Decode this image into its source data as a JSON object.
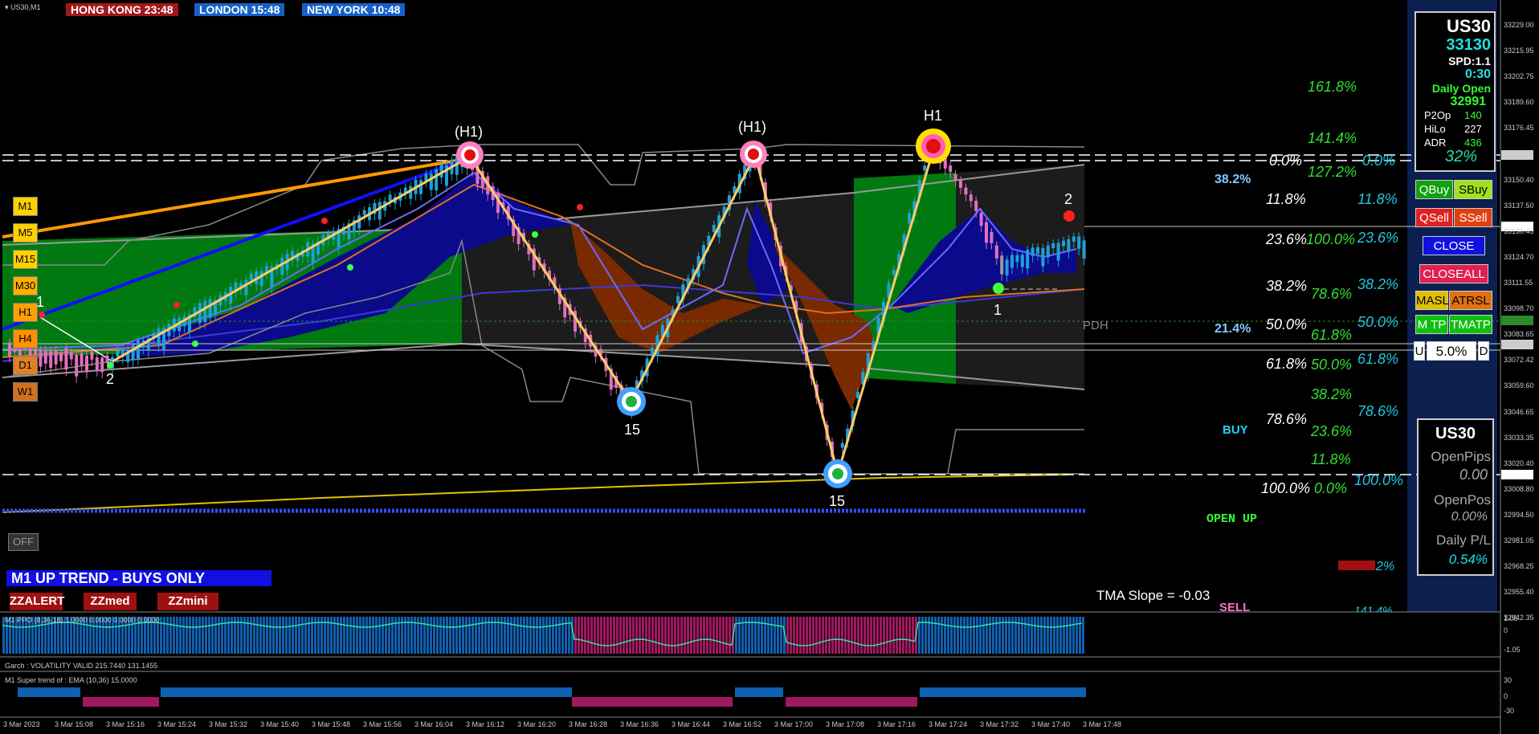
{
  "window": {
    "title": "US30,M1"
  },
  "clocks": [
    {
      "label": "HONG KONG 23:48",
      "color": "#a01818"
    },
    {
      "label": "LONDON  15:48",
      "color": "#1560c8"
    },
    {
      "label": "NEW YORK  10:48",
      "color": "#1560c8"
    }
  ],
  "timeframes": [
    {
      "label": "M1",
      "color": "#ffd000"
    },
    {
      "label": "M5",
      "color": "#ffd000"
    },
    {
      "label": "M15",
      "color": "#ffd000"
    },
    {
      "label": "M30",
      "color": "#ffb000"
    },
    {
      "label": "H1",
      "color": "#ffa000"
    },
    {
      "label": "H4",
      "color": "#ff9000"
    },
    {
      "label": "D1",
      "color": "#e08020"
    },
    {
      "label": "W1",
      "color": "#d07020"
    }
  ],
  "swing_labels": {
    "h1_left": "(H1)",
    "h1_mid": "(H1)",
    "h1_right": "H1",
    "low_mid": "15",
    "low_right": "15",
    "num_2_left": "2",
    "num_1_left": "1",
    "num_2_right": "2",
    "num_1_right": "1"
  },
  "fib_levels": {
    "col_a": [
      "0.0%",
      "11.8%",
      "23.6%",
      "38.2%",
      "50.0%",
      "61.8%",
      "78.6%",
      "100.0%"
    ],
    "col_b": [
      "161.8%",
      "141.4%",
      "127.2%",
      "100.0%",
      "78.6%",
      "61.8%",
      "50.0%",
      "38.2%",
      "23.6%",
      "11.8%",
      "0.0%"
    ],
    "col_c": [
      "0.0%",
      "11.8%",
      "23.6%",
      "38.2%",
      "50.0%",
      "61.8%",
      "78.6%",
      "100.0%"
    ],
    "extra_382": "38.2%",
    "extra_214": "21.4%",
    "bottom_partial": "11.2%",
    "bottom_partial2": "141.4%"
  },
  "signals": {
    "buy": "BUY",
    "open_up": "OPEN UP",
    "sell": "SELL",
    "pdh": "PDH"
  },
  "tma_slope": "TMA Slope = -0.03",
  "trend_banner": "M1 UP TREND - BUYS ONLY",
  "off_button": "OFF",
  "zz_buttons": [
    "ZZALERT",
    "ZZmed",
    "ZZmini"
  ],
  "info_panel": {
    "symbol": "US30",
    "price": "33130",
    "spread": "SPD:1.1",
    "timer": "0:30",
    "daily_open_label": "Daily Open",
    "daily_open": "32991",
    "rows": [
      {
        "label": "P2Op",
        "value": "140"
      },
      {
        "label": "HiLo",
        "value": "227"
      },
      {
        "label": "ADR",
        "value": "436"
      }
    ],
    "adr_pct": "32%"
  },
  "trade_buttons": {
    "qbuy": "QBuy",
    "sbuy": "SBuy",
    "qsell": "QSell",
    "ssell": "SSell",
    "close": "CLOSE",
    "closeall": "CLOSEALL",
    "masl": "MASL",
    "atrsl": "ATRSL",
    "mtp": "M TP",
    "tmatp": "TMATP",
    "u": "U",
    "risk": "5.0%",
    "d": "D"
  },
  "stats_panel": {
    "symbol": "US30",
    "open_pips_label": "OpenPips",
    "open_pips": "0.00",
    "open_pos_label": "OpenPos",
    "open_pos": "0.00%",
    "daily_pl_label": "Daily P/L",
    "daily_pl": "0.54%"
  },
  "price_axis": [
    "33229.00",
    "33215.95",
    "33202.75",
    "33189.60",
    "33176.45",
    "33165.77",
    "33150.40",
    "33137.50",
    "33130.45",
    "33124.70",
    "33111.55",
    "33098.70",
    "33083.65",
    "33072.42",
    "33059.60",
    "33046.65",
    "33033.35",
    "33020.40",
    "33008.80",
    "32994.50",
    "32981.05",
    "32968.25",
    "32955.40",
    "32942.35"
  ],
  "time_axis": [
    "3 Mar 2023",
    "3 Mar 15:08",
    "3 Mar 15:16",
    "3 Mar 15:24",
    "3 Mar 15:32",
    "3 Mar 15:40",
    "3 Mar 15:48",
    "3 Mar 15:56",
    "3 Mar 16:04",
    "3 Mar 16:12",
    "3 Mar 16:20",
    "3 Mar 16:28",
    "3 Mar 16:36",
    "3 Mar 16:44",
    "3 Mar 16:52",
    "3 Mar 17:00",
    "3 Mar 17:08",
    "3 Mar 17:16",
    "3 Mar 17:24",
    "3 Mar 17:32",
    "3 Mar 17:40",
    "3 Mar 17:48"
  ],
  "sub_windows": [
    {
      "title": "M1 PPO (8,36,18) 1.0000 0.0000 0.0000 0.0000",
      "scale": [
        "1.05",
        "0",
        "-1.05"
      ]
    },
    {
      "title": "Garch : VOLATILITY VALID 215.7440 131.1455",
      "scale": []
    },
    {
      "title": "M1  Super trend of : EMA (10,36)  15.0000",
      "scale": [
        "30",
        "0",
        "-30"
      ]
    }
  ],
  "colors": {
    "bull_zone": "#007a10",
    "bear_zone": "#1c1c1c",
    "ma_fill_up": "#0a0a8a",
    "ma_fill_down": "#7a2a00",
    "zigzag": "#ffcc66",
    "buy_blue": "#1ea0d8",
    "sell_pink": "#e070c0"
  }
}
